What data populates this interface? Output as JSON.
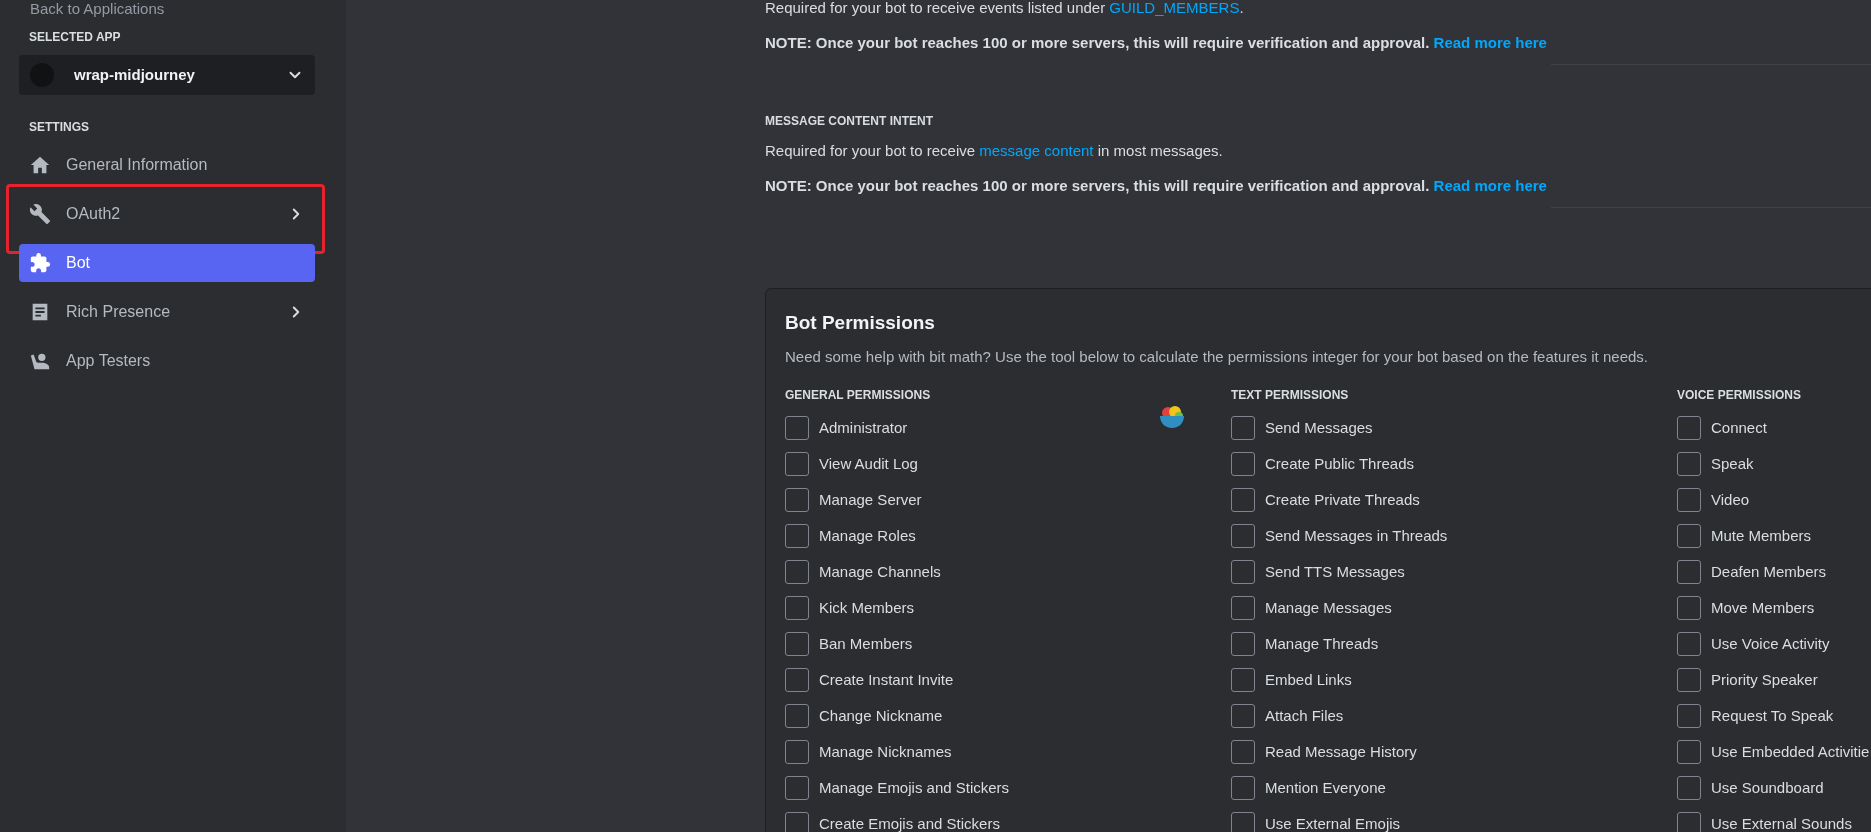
{
  "sidebar": {
    "back_link": "Back to Applications",
    "selected_app_label": "SELECTED APP",
    "app_select": {
      "value": "wrap-midjourney"
    },
    "settings_label": "SETTINGS",
    "items": [
      {
        "label": "General Information",
        "selected": false,
        "has_submenu": false,
        "annotated": false
      },
      {
        "label": "OAuth2",
        "selected": false,
        "has_submenu": true,
        "annotated": true
      },
      {
        "label": "Bot",
        "selected": true,
        "has_submenu": false,
        "annotated": false
      },
      {
        "label": "Rich Presence",
        "selected": false,
        "has_submenu": true,
        "annotated": false
      },
      {
        "label": "App Testers",
        "selected": false,
        "has_submenu": false,
        "annotated": false
      }
    ]
  },
  "intents": [
    {
      "description": {
        "before": "Required for your bot to receive events listed under ",
        "link": "GUILD_MEMBERS",
        "after": "."
      },
      "note": {
        "text": "NOTE: Once your bot reaches 100 or more servers, this will require verification and approval.",
        "link": "Read more here"
      }
    },
    {
      "heading": "MESSAGE CONTENT INTENT",
      "description": {
        "before": "Required for your bot to receive ",
        "link": "message content",
        "after": " in most messages."
      },
      "note": {
        "text": "NOTE: Once your bot reaches 100 or more servers, this will require verification and approval.",
        "link": "Read more here"
      }
    }
  ],
  "permissions": {
    "title": "Bot Permissions",
    "description": "Need some help with bit math? Use the tool below to calculate the permissions integer for your bot based on the features it needs.",
    "columns": [
      {
        "heading": "GENERAL PERMISSIONS",
        "items": [
          {
            "label": "Administrator",
            "checked": false
          },
          {
            "label": "View Audit Log",
            "checked": false
          },
          {
            "label": "Manage Server",
            "checked": false
          },
          {
            "label": "Manage Roles",
            "checked": false
          },
          {
            "label": "Manage Channels",
            "checked": false
          },
          {
            "label": "Kick Members",
            "checked": false
          },
          {
            "label": "Ban Members",
            "checked": false
          },
          {
            "label": "Create Instant Invite",
            "checked": false
          },
          {
            "label": "Change Nickname",
            "checked": false
          },
          {
            "label": "Manage Nicknames",
            "checked": false
          },
          {
            "label": "Manage Emojis and Stickers",
            "checked": false
          },
          {
            "label": "Create Emojis and Stickers",
            "checked": false
          }
        ]
      },
      {
        "heading": "TEXT PERMISSIONS",
        "items": [
          {
            "label": "Send Messages",
            "checked": false
          },
          {
            "label": "Create Public Threads",
            "checked": false
          },
          {
            "label": "Create Private Threads",
            "checked": false
          },
          {
            "label": "Send Messages in Threads",
            "checked": false
          },
          {
            "label": "Send TTS Messages",
            "checked": false
          },
          {
            "label": "Manage Messages",
            "checked": false
          },
          {
            "label": "Manage Threads",
            "checked": false
          },
          {
            "label": "Embed Links",
            "checked": false
          },
          {
            "label": "Attach Files",
            "checked": false
          },
          {
            "label": "Read Message History",
            "checked": false
          },
          {
            "label": "Mention Everyone",
            "checked": false
          },
          {
            "label": "Use External Emojis",
            "checked": false
          }
        ]
      },
      {
        "heading": "VOICE PERMISSIONS",
        "items": [
          {
            "label": "Connect",
            "checked": false
          },
          {
            "label": "Speak",
            "checked": false
          },
          {
            "label": "Video",
            "checked": false
          },
          {
            "label": "Mute Members",
            "checked": false
          },
          {
            "label": "Deafen Members",
            "checked": false
          },
          {
            "label": "Move Members",
            "checked": false
          },
          {
            "label": "Use Voice Activity",
            "checked": false
          },
          {
            "label": "Priority Speaker",
            "checked": false
          },
          {
            "label": "Request To Speak",
            "checked": false
          },
          {
            "label": "Use Embedded Activitie",
            "checked": false
          },
          {
            "label": "Use Soundboard",
            "checked": false
          },
          {
            "label": "Use External Sounds",
            "checked": false
          }
        ]
      }
    ]
  }
}
